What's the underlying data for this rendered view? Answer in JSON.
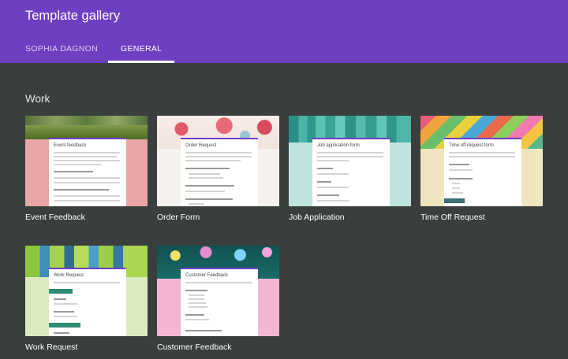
{
  "header": {
    "title": "Template gallery",
    "tabs": [
      {
        "label": "SOPHIA DAGNON",
        "active": false
      },
      {
        "label": "GENERAL",
        "active": true
      }
    ]
  },
  "section": {
    "title": "Work"
  },
  "templates": [
    {
      "label": "Event Feedback",
      "form_title": "Event feedback"
    },
    {
      "label": "Order Form",
      "form_title": "Order Request"
    },
    {
      "label": "Job Application",
      "form_title": "Job application form"
    },
    {
      "label": "Time Off Request",
      "form_title": "Time off request form"
    },
    {
      "label": "Work Request",
      "form_title": "Work Request"
    },
    {
      "label": "Customer Feedback",
      "form_title": "Customer Feedback"
    }
  ],
  "colors": {
    "header": "#6f3fc2",
    "background": "#3a3f3e"
  }
}
